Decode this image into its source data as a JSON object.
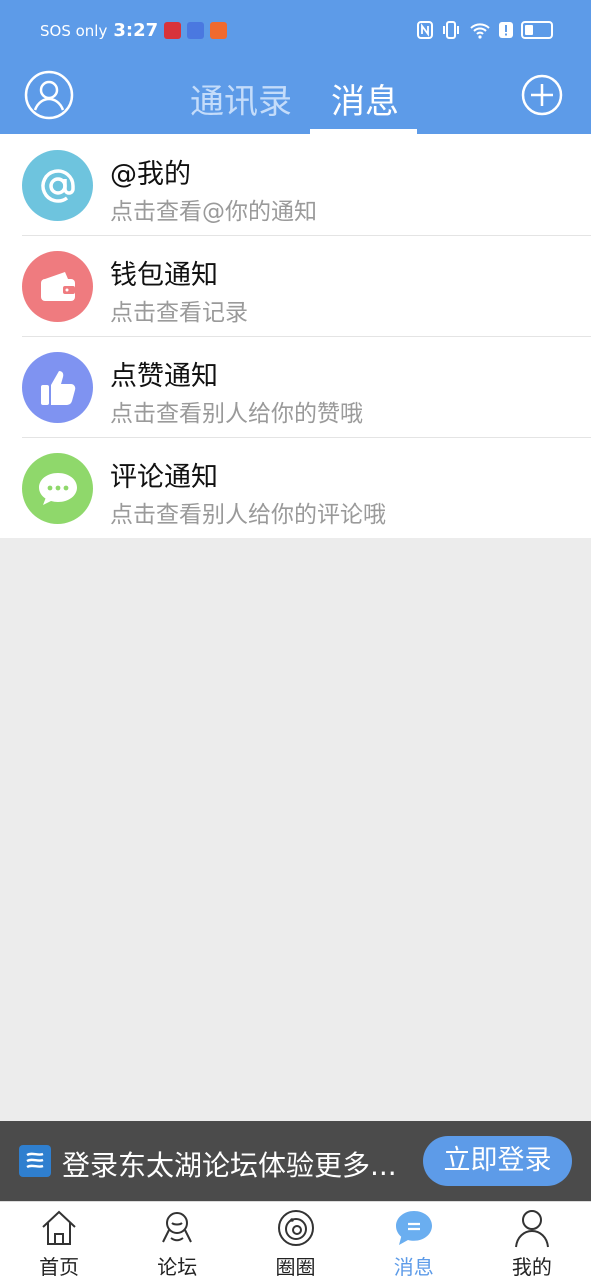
{
  "status_bar": {
    "sos_text": "SOS only",
    "time": "3:27"
  },
  "header": {
    "tabs": [
      {
        "label": "通讯录",
        "active": false
      },
      {
        "label": "消息",
        "active": true
      }
    ]
  },
  "messages": [
    {
      "icon": "at-icon",
      "title": "@我的",
      "subtitle": "点击查看@你的通知",
      "color": "#6ec4de"
    },
    {
      "icon": "wallet-icon",
      "title": "钱包通知",
      "subtitle": "点击查看记录",
      "color": "#ef7b7f"
    },
    {
      "icon": "thumbs-up-icon",
      "title": "点赞通知",
      "subtitle": "点击查看别人给你的赞哦",
      "color": "#7f93f1"
    },
    {
      "icon": "chat-bubble-icon",
      "title": "评论通知",
      "subtitle": "点击查看别人给你的评论哦",
      "color": "#8fd86b"
    }
  ],
  "login_banner": {
    "text": "登录东太湖论坛体验更多...",
    "button": "立即登录"
  },
  "bottom_nav": [
    {
      "icon": "home-icon",
      "label": "首页",
      "active": false
    },
    {
      "icon": "forum-icon",
      "label": "论坛",
      "active": false
    },
    {
      "icon": "circle-icon",
      "label": "圈圈",
      "active": false
    },
    {
      "icon": "message-icon",
      "label": "消息",
      "active": true
    },
    {
      "icon": "user-icon",
      "label": "我的",
      "active": false
    }
  ],
  "colors": {
    "primary": "#5d9be8",
    "background": "#ececec",
    "banner": "#4b4b4b"
  }
}
